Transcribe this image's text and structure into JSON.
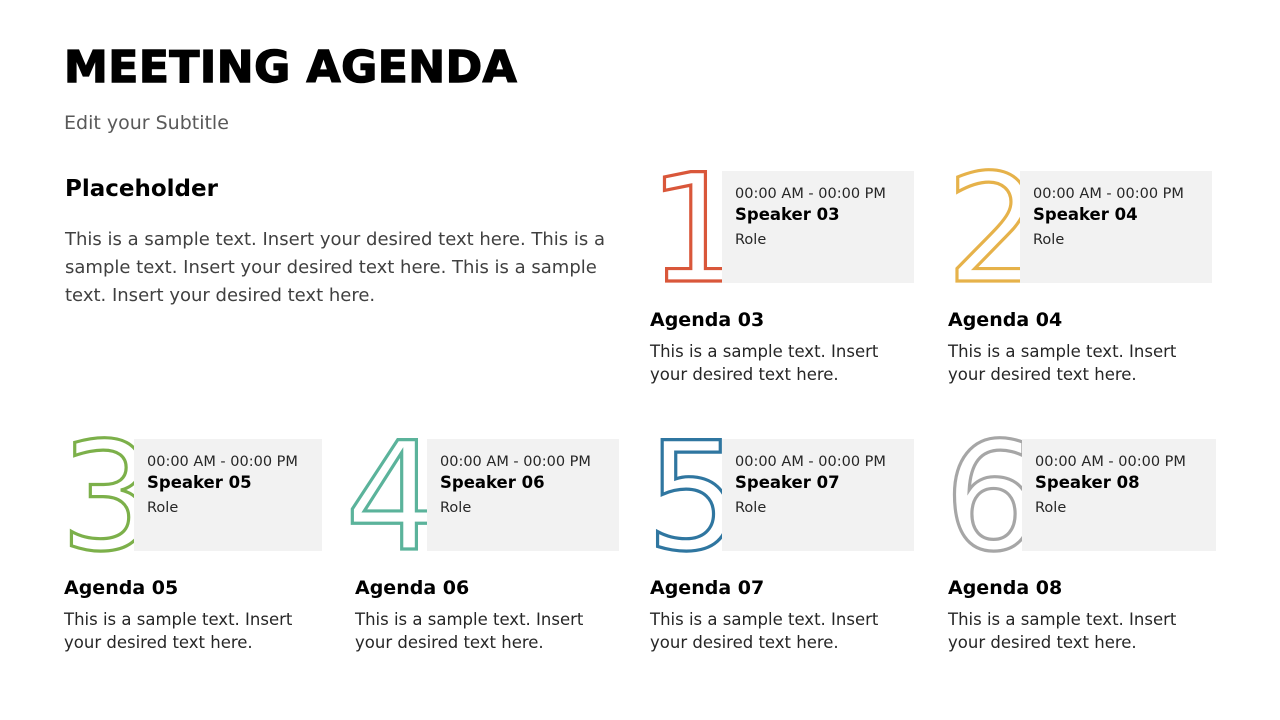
{
  "header": {
    "title": "MEETING AGENDA",
    "subtitle": "Edit your Subtitle"
  },
  "placeholder": {
    "heading": "Placeholder",
    "body": "This is a sample text. Insert your desired text here. This is a sample text. Insert your desired text here. This is a sample text. Insert your desired text here."
  },
  "agendas": [
    {
      "number": "1",
      "color": "#D9573A",
      "time": "00:00 AM  -  00:00 PM",
      "speaker": "Speaker 03",
      "role": "Role",
      "title": "Agenda 03",
      "desc": "This is a sample text. Insert your desired text here."
    },
    {
      "number": "2",
      "color": "#E6B24A",
      "time": "00:00 AM  -  00:00 PM",
      "speaker": "Speaker 04",
      "role": "Role",
      "title": "Agenda 04",
      "desc": "This is a sample text. Insert your desired text here."
    },
    {
      "number": "3",
      "color": "#7CB04A",
      "time": "00:00 AM  -  00:00 PM",
      "speaker": "Speaker 05",
      "role": "Role",
      "title": "Agenda 05",
      "desc": "This is a sample text. Insert your desired text here."
    },
    {
      "number": "4",
      "color": "#5BB39B",
      "time": "00:00 AM  -  00:00 PM",
      "speaker": "Speaker 06",
      "role": "Role",
      "title": "Agenda 06",
      "desc": "This is a sample text. Insert your desired text here."
    },
    {
      "number": "5",
      "color": "#2F76A0",
      "time": "00:00 AM  -  00:00 PM",
      "speaker": "Speaker 07",
      "role": "Role",
      "title": "Agenda 07",
      "desc": "This is a sample text. Insert your desired text here."
    },
    {
      "number": "6",
      "color": "#A6A6A6",
      "time": "00:00 AM  -  00:00 PM",
      "speaker": "Speaker 08",
      "role": "Role",
      "title": "Agenda 08",
      "desc": "This is a sample text. Insert your desired text here."
    }
  ]
}
